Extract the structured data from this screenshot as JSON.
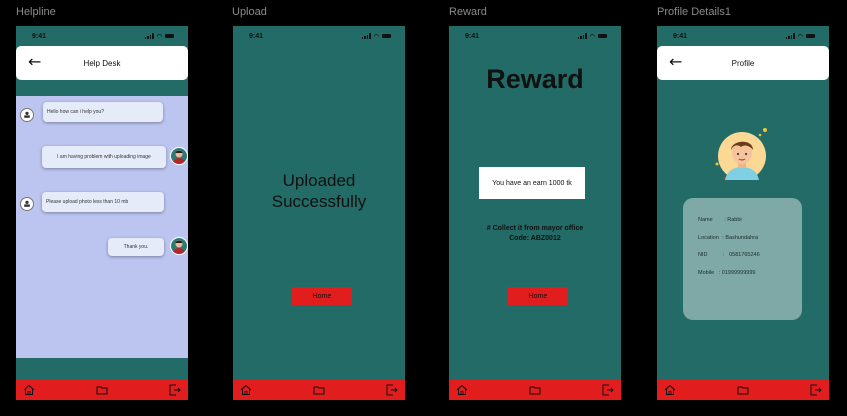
{
  "frames": {
    "helpline": {
      "label": "Helpline"
    },
    "upload": {
      "label": "Upload"
    },
    "reward": {
      "label": "Reward"
    },
    "profile": {
      "label": "Profile Details1"
    }
  },
  "status": {
    "time": "9:41"
  },
  "helpline": {
    "title": "Help Desk",
    "messages": [
      {
        "from": "bot",
        "text": "Hello how can i help you?"
      },
      {
        "from": "user",
        "text": "I am having problem with uploading image"
      },
      {
        "from": "bot",
        "text": "Please upload photo less than 10 mb"
      },
      {
        "from": "user",
        "text": "Thank you."
      }
    ]
  },
  "upload": {
    "line1": "Uploaded",
    "line2": "Successfully",
    "home_label": "Home"
  },
  "reward": {
    "title": "Reward",
    "earn_text": "You have an earn 1000 tk",
    "collect_line": "# Collect it from mayor office",
    "code_line": "Code: ABZ0012",
    "home_label": "Home"
  },
  "profile": {
    "title": "Profile",
    "fields": [
      {
        "label": "Name",
        "sep": ":",
        "value": "Rabbi"
      },
      {
        "label": "Location",
        "sep": ":",
        "value": "Bashundahra"
      },
      {
        "label": "NID",
        "sep": ":",
        "value": "0581765246"
      },
      {
        "label": "Mobile",
        "sep": ":",
        "value": "01999999999"
      }
    ]
  },
  "nav": {
    "icons": [
      "home-icon",
      "folder-icon",
      "logout-icon"
    ]
  },
  "colors": {
    "teal": "#226b67",
    "red": "#e21d1d",
    "chat_bg": "#bcc4f0",
    "card": "#7fa9a6"
  }
}
